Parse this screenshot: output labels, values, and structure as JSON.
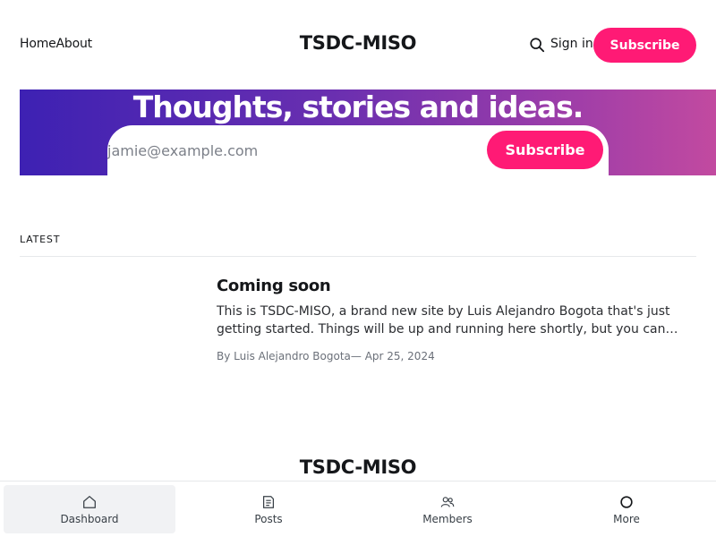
{
  "header": {
    "nav": [
      {
        "label": "Home"
      },
      {
        "label": "About"
      }
    ],
    "site_title": "TSDC-MISO",
    "signin_label": "Sign in",
    "subscribe_label": "Subscribe"
  },
  "hero": {
    "title": "Thoughts, stories and ideas.",
    "email_placeholder": "jamie@example.com",
    "subscribe_label": "Subscribe"
  },
  "latest": {
    "heading": "LATEST",
    "post": {
      "title": "Coming soon",
      "excerpt": "This is TSDC-MISO, a brand new site by Luis Alejandro Bogota that's just getting started. Things will be up and running here shortly, but you can…",
      "meta": "By Luis Alejandro Bogota— Apr 25, 2024"
    }
  },
  "footer": {
    "site_title": "TSDC-MISO"
  },
  "bottom_bar": {
    "tabs": [
      {
        "label": "Dashboard",
        "icon": "home-icon",
        "active": true
      },
      {
        "label": "Posts",
        "icon": "posts-icon"
      },
      {
        "label": "Members",
        "icon": "members-icon"
      },
      {
        "label": "More",
        "icon": "more-icon"
      }
    ]
  },
  "colors": {
    "accent": "#ff1a75",
    "hero_gradient_start": "#3d21b3",
    "hero_gradient_end": "#c24aa0"
  }
}
